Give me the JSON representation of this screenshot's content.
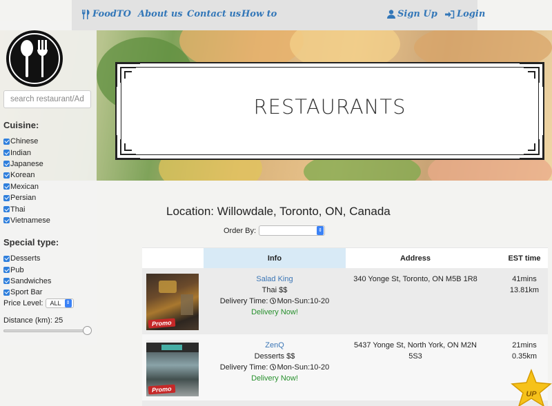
{
  "nav": {
    "brand": "FoodTO",
    "about": "About us",
    "contact": "Contact us",
    "howto": "How to",
    "signup": "Sign Up",
    "login": "Login"
  },
  "banner": {
    "title": "RESTAURANTS"
  },
  "sidebar": {
    "search_placeholder": "search restaurant/Ad",
    "cuisine_title": "Cuisine:",
    "cuisines": [
      "Chinese",
      "Indian",
      "Japanese",
      "Korean",
      "Mexican",
      "Persian",
      "Thai",
      "Vietnamese"
    ],
    "special_title": "Special type:",
    "special_types": [
      "Desserts",
      "Pub",
      "Sandwiches",
      "Sport Bar"
    ],
    "price_label": "Price Level:",
    "price_value": "ALL",
    "distance_label": "Distance (km): 25",
    "distance_value": 25
  },
  "main": {
    "location": "Location: Willowdale, Toronto, ON, Canada",
    "order_label": "Order By:",
    "columns": {
      "info": "Info",
      "address": "Address",
      "est": "EST time"
    },
    "restaurants": [
      {
        "name": "Salad King",
        "category": "Thai  $$",
        "delivery_label": "Delivery Time:",
        "delivery_hours": "Mon-Sun:10-20",
        "delivery_now": "Delivery Now!",
        "address": "340 Yonge St, Toronto, ON M5B 1R8",
        "time": "41mins",
        "distance": "13.81km",
        "promo": "Promo"
      },
      {
        "name": "ZenQ",
        "category": "Desserts  $$",
        "delivery_label": "Delivery Time:",
        "delivery_hours": "Mon-Sun:10-20",
        "delivery_now": "Delivery Now!",
        "address": "5437 Yonge St, North York, ON M2N 5S3",
        "time": "21mins",
        "distance": "0.35km",
        "promo": "Promo"
      }
    ]
  },
  "scroll_top": {
    "label": "UP"
  }
}
